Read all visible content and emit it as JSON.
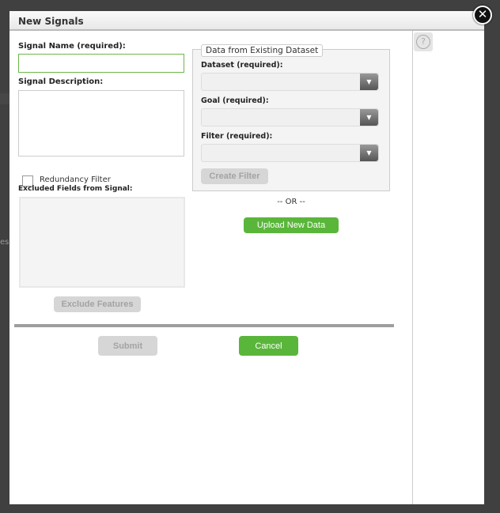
{
  "background": {
    "partial_text": "es"
  },
  "dialog": {
    "title": "New Signals",
    "close_icon": "close-icon",
    "help_icon": "?",
    "signal_name_label": "Signal Name (required):",
    "signal_name_value": "",
    "signal_description_label": "Signal Description:",
    "signal_description_value": "",
    "redundancy_filter_label": "Redundancy Filter",
    "redundancy_filter_checked": false,
    "excluded_fields_label": "Excluded Fields from Signal:",
    "exclude_features_button": "Exclude Features",
    "existing_dataset": {
      "legend": "Data from Existing Dataset",
      "dataset_label": "Dataset (required):",
      "goal_label": "Goal (required):",
      "filter_label": "Filter (required):",
      "create_filter_button": "Create Filter"
    },
    "or_text": "-- OR --",
    "upload_button": "Upload New Data",
    "submit_button": "Submit",
    "cancel_button": "Cancel",
    "colors": {
      "accent": "#5ab63a",
      "disabled": "#d6d6d6"
    }
  }
}
